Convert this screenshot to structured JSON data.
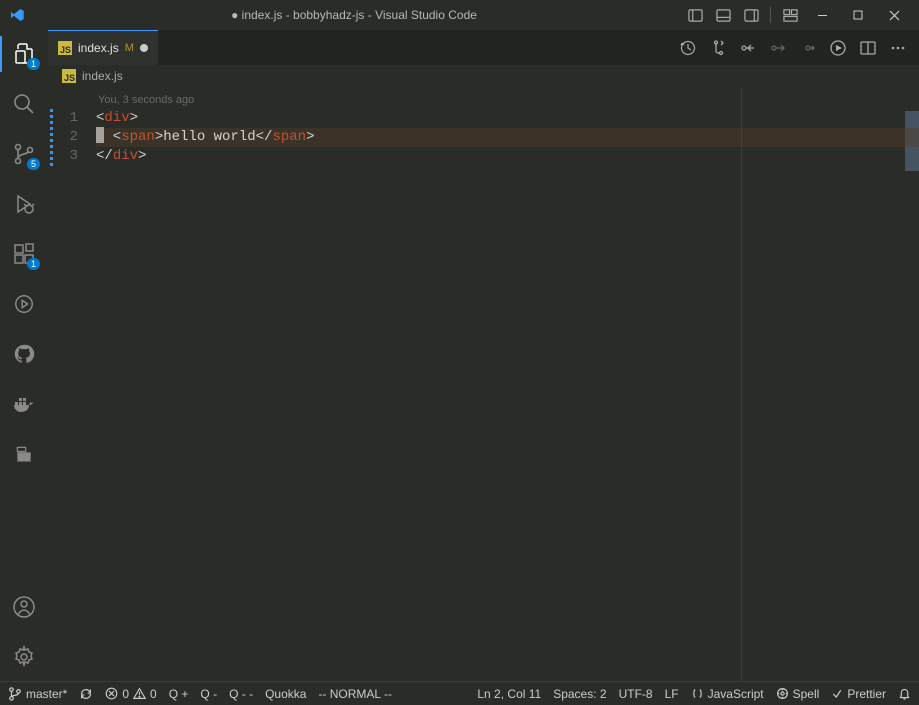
{
  "titlebar": {
    "dirty_dot": "●",
    "title": "index.js - bobbyhadz-js - Visual Studio Code"
  },
  "activity": {
    "explorer_badge": "1",
    "scm_badge": "5",
    "ext_badge": "1"
  },
  "tab": {
    "filename": "index.js",
    "mod": "M"
  },
  "breadcrumb": {
    "filename": "index.js"
  },
  "editor": {
    "lens": "You, 3 seconds ago",
    "lines": {
      "l1": "1",
      "l2": "2",
      "l3": "3"
    },
    "code": {
      "l1_open": "<",
      "l1_tag": "div",
      "l1_close": ">",
      "l2_pre": "  <",
      "l2_tag1": "span",
      "l2_gt": ">",
      "l2_text": "hello world",
      "l2_end": "</",
      "l2_tag2": "span",
      "l2_last": ">",
      "l3_open": "</",
      "l3_tag": "div",
      "l3_close": ">"
    }
  },
  "statusbar": {
    "branch": "master*",
    "errors": "0",
    "warnings": "0",
    "q1": "Q +",
    "q2": "Q -",
    "q3": "Q - -",
    "quokka": "Quokka",
    "vim": "-- NORMAL --",
    "cursor": "Ln 2, Col 11",
    "spaces": "Spaces: 2",
    "encoding": "UTF-8",
    "eol": "LF",
    "language": "JavaScript",
    "spell": "Spell",
    "prettier": "Prettier"
  }
}
